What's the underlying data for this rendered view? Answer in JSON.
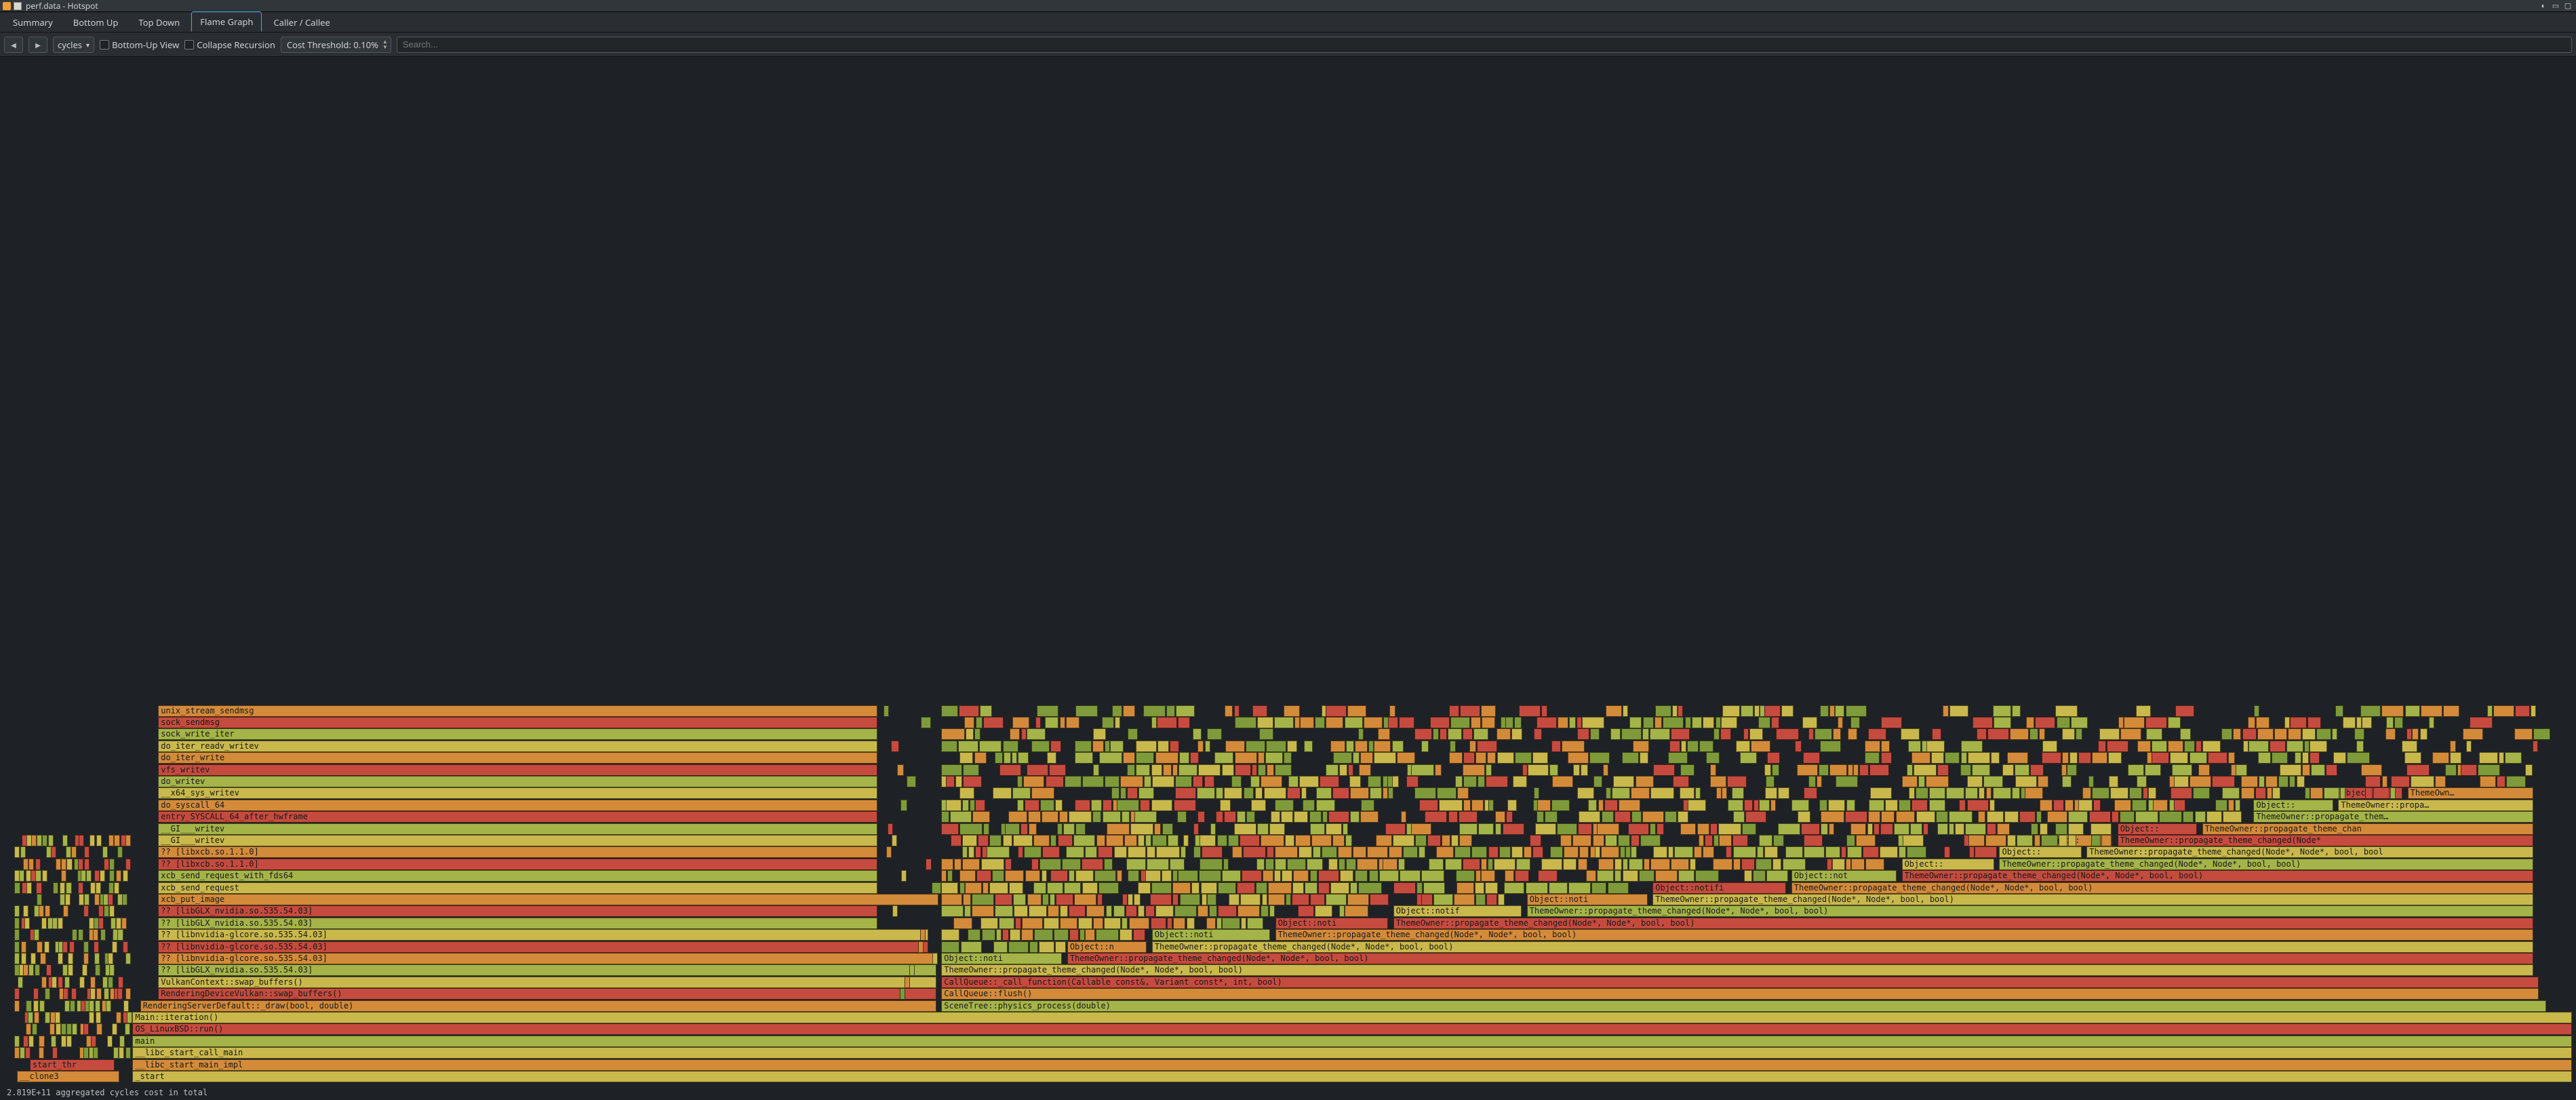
{
  "window": {
    "title": "perf.data - Hotspot"
  },
  "tabs": {
    "summary": "Summary",
    "bottom_up": "Bottom Up",
    "top_down": "Top Down",
    "flame_graph": "Flame Graph",
    "caller_callee": "Caller / Callee",
    "active": "flame_graph"
  },
  "toolbar": {
    "event_selector": "cycles",
    "bottom_up_view": "Bottom-Up View",
    "collapse_recursion": "Collapse Recursion",
    "cost_threshold": "Cost Threshold: 0.10%",
    "search_placeholder": "Search..."
  },
  "status": {
    "text": "2.819E+11 aggregated cycles cost in total"
  },
  "flame": {
    "row_h": 17.4,
    "total_rows": 32,
    "palette": {
      "r": "#c54b3f",
      "o": "#d38b3a",
      "y": "#c9b84c",
      "g": "#a4b448",
      "dg": "#7f9a3a"
    },
    "frames": [
      {
        "row": 0,
        "x": 0.5,
        "w": 4.0,
        "c": "o",
        "label": "__clone3"
      },
      {
        "row": 0,
        "x": 5.0,
        "w": 95.0,
        "c": "y",
        "label": "_start"
      },
      {
        "row": 1,
        "x": 1.0,
        "w": 3.3,
        "c": "r",
        "label": "start_thr"
      },
      {
        "row": 1,
        "x": 5.0,
        "w": 95.0,
        "c": "o",
        "label": "__libc_start_main_impl"
      },
      {
        "row": 2,
        "x": 5.0,
        "w": 95.0,
        "c": "y",
        "label": "__libc_start_call_main"
      },
      {
        "row": 3,
        "x": 5.0,
        "w": 95.0,
        "c": "g",
        "label": "main"
      },
      {
        "row": 4,
        "x": 5.0,
        "w": 95.0,
        "c": "r",
        "label": "OS_LinuxBSD::run()"
      },
      {
        "row": 5,
        "x": 5.0,
        "w": 95.0,
        "c": "y",
        "label": "Main::iteration()"
      },
      {
        "row": 6,
        "x": 5.3,
        "w": 31.0,
        "c": "o",
        "label": "RenderingServerDefault::_draw(bool, double)"
      },
      {
        "row": 6,
        "x": 36.5,
        "w": 62.5,
        "c": "g",
        "label": "SceneTree::physics_process(double)"
      },
      {
        "row": 7,
        "x": 6.0,
        "w": 30.3,
        "c": "r",
        "label": "RenderingDeviceVulkan::swap_buffers()"
      },
      {
        "row": 7,
        "x": 36.5,
        "w": 62.2,
        "c": "o",
        "label": "CallQueue::flush()"
      },
      {
        "row": 8,
        "x": 6.0,
        "w": 30.3,
        "c": "y",
        "label": "VulkanContext::swap_buffers()"
      },
      {
        "row": 8,
        "x": 36.5,
        "w": 62.2,
        "c": "r",
        "label": "CallQueue::_call_function(Callable const&, Variant const*, int, bool)"
      },
      {
        "row": 9,
        "x": 6.0,
        "w": 30.3,
        "c": "g",
        "label": "?? [libGLX_nvidia.so.535.54.03]"
      },
      {
        "row": 9,
        "x": 36.5,
        "w": 62.0,
        "c": "y",
        "label": "ThemeOwner::propagate_theme_changed(Node*, Node*, bool, bool)"
      },
      {
        "row": 10,
        "x": 6.0,
        "w": 30.3,
        "c": "o",
        "label": "?? [libnvidia-glcore.so.535.54.03]"
      },
      {
        "row": 10,
        "x": 36.5,
        "w": 4.7,
        "c": "g",
        "label": "Object::noti"
      },
      {
        "row": 10,
        "x": 41.4,
        "w": 57.1,
        "c": "r",
        "label": "ThemeOwner::propagate_theme_changed(Node*, Node*, bool, bool)"
      },
      {
        "row": 11,
        "x": 6.0,
        "w": 30.0,
        "c": "r",
        "label": "?? [libnvidia-glcore.so.535.54.03]"
      },
      {
        "row": 11,
        "x": 41.4,
        "w": 3.1,
        "c": "o",
        "label": "Object::n"
      },
      {
        "row": 11,
        "x": 44.7,
        "w": 53.8,
        "c": "y",
        "label": "ThemeOwner::propagate_theme_changed(Node*, Node*, bool, bool)"
      },
      {
        "row": 12,
        "x": 6.0,
        "w": 30.0,
        "c": "y",
        "label": "?? [libnvidia-glcore.so.535.54.03]"
      },
      {
        "row": 12,
        "x": 44.7,
        "w": 4.6,
        "c": "g",
        "label": "Object::noti"
      },
      {
        "row": 12,
        "x": 49.5,
        "w": 49.0,
        "c": "o",
        "label": "ThemeOwner::propagate_theme_changed(Node*, Node*, bool, bool)"
      },
      {
        "row": 13,
        "x": 6.0,
        "w": 28.0,
        "c": "g",
        "label": "?? [libGLX_nvidia.so.535.54.03]"
      },
      {
        "row": 13,
        "x": 49.5,
        "w": 4.4,
        "c": "r",
        "label": "Object::noti"
      },
      {
        "row": 13,
        "x": 54.1,
        "w": 44.4,
        "c": "r",
        "label": "ThemeOwner::propagate_theme_changed(Node*, Node*, bool, bool)"
      },
      {
        "row": 14,
        "x": 6.0,
        "w": 28.0,
        "c": "r",
        "label": "?? [libGLX_nvidia.so.535.54.03]"
      },
      {
        "row": 14,
        "x": 54.1,
        "w": 5.0,
        "c": "y",
        "label": "Object::notif"
      },
      {
        "row": 14,
        "x": 59.3,
        "w": 39.2,
        "c": "g",
        "label": "ThemeOwner::propagate_theme_changed(Node*, Node*, bool, bool)"
      },
      {
        "row": 15,
        "x": 6.0,
        "w": 30.4,
        "c": "o",
        "label": "xcb_put_image"
      },
      {
        "row": 15,
        "x": 59.3,
        "w": 4.7,
        "c": "o",
        "label": "Object::noti"
      },
      {
        "row": 15,
        "x": 64.2,
        "w": 34.3,
        "c": "y",
        "label": "ThemeOwner::propagate_theme_changed(Node*, Node*, bool, bool)"
      },
      {
        "row": 16,
        "x": 6.0,
        "w": 28.0,
        "c": "y",
        "label": "xcb_send_request"
      },
      {
        "row": 16,
        "x": 64.2,
        "w": 5.2,
        "c": "r",
        "label": "Object::notifi"
      },
      {
        "row": 16,
        "x": 69.6,
        "w": 28.9,
        "c": "o",
        "label": "ThemeOwner::propagate_theme_changed(Node*, Node*, bool, bool)"
      },
      {
        "row": 17,
        "x": 6.0,
        "w": 28.0,
        "c": "g",
        "label": "xcb_send_request_with_fds64"
      },
      {
        "row": 17,
        "x": 69.6,
        "w": 4.1,
        "c": "g",
        "label": "Object::not"
      },
      {
        "row": 17,
        "x": 73.9,
        "w": 24.6,
        "c": "r",
        "label": "ThemeOwner::propagate_theme_changed(Node*, Node*, bool, bool)"
      },
      {
        "row": 18,
        "x": 6.0,
        "w": 28.0,
        "c": "r",
        "label": "?? [libxcb.so.1.1.0]"
      },
      {
        "row": 18,
        "x": 73.9,
        "w": 3.6,
        "c": "y",
        "label": "Object::"
      },
      {
        "row": 18,
        "x": 77.7,
        "w": 20.8,
        "c": "g",
        "label": "ThemeOwner::propagate_theme_changed(Node*, Node*, bool, bool)"
      },
      {
        "row": 19,
        "x": 6.0,
        "w": 28.0,
        "c": "o",
        "label": "?? [libxcb.so.1.1.0]"
      },
      {
        "row": 19,
        "x": 77.7,
        "w": 3.2,
        "c": "y",
        "label": "Object::"
      },
      {
        "row": 19,
        "x": 81.1,
        "w": 17.4,
        "c": "y",
        "label": "ThemeOwner::propagate_theme_changed(Node*, Node*, bool, bool"
      },
      {
        "row": 20,
        "x": 6.0,
        "w": 28.0,
        "c": "y",
        "label": "__GI___writev"
      },
      {
        "row": 20,
        "x": 79.4,
        "w": 2.7,
        "c": "o",
        "label": "Object:"
      },
      {
        "row": 20,
        "x": 82.3,
        "w": 16.2,
        "c": "r",
        "label": "ThemeOwner::propagate_theme_changed(Node*"
      },
      {
        "row": 21,
        "x": 6.0,
        "w": 28.0,
        "c": "g",
        "label": "__GI___writev"
      },
      {
        "row": 21,
        "x": 82.3,
        "w": 3.1,
        "c": "r",
        "label": "Object::"
      },
      {
        "row": 21,
        "x": 85.6,
        "w": 12.9,
        "c": "o",
        "label": "ThemeOwner::propagate_theme_chan"
      },
      {
        "row": 22,
        "x": 6.0,
        "w": 28.0,
        "c": "r",
        "label": "entry_SYSCALL_64_after_hwframe"
      },
      {
        "row": 22,
        "x": 87.6,
        "w": 10.9,
        "c": "g",
        "label": "ThemeOwner::propagate_them…"
      },
      {
        "row": 23,
        "x": 6.0,
        "w": 28.0,
        "c": "o",
        "label": "do_syscall_64"
      },
      {
        "row": 23,
        "x": 87.6,
        "w": 3.1,
        "c": "g",
        "label": "Object::"
      },
      {
        "row": 23,
        "x": 90.9,
        "w": 7.6,
        "c": "y",
        "label": "ThemeOwner::propa…"
      },
      {
        "row": 24,
        "x": 6.0,
        "w": 28.0,
        "c": "y",
        "label": "__x64_sys_writev"
      },
      {
        "row": 24,
        "x": 90.9,
        "w": 2.5,
        "c": "r",
        "label": "Objec…"
      },
      {
        "row": 24,
        "x": 93.6,
        "w": 4.9,
        "c": "o",
        "label": "ThemeOwn…"
      },
      {
        "row": 25,
        "x": 6.0,
        "w": 28.0,
        "c": "g",
        "label": "do_writev"
      },
      {
        "row": 26,
        "x": 6.0,
        "w": 28.0,
        "c": "r",
        "label": "vfs_writev"
      },
      {
        "row": 27,
        "x": 6.0,
        "w": 28.0,
        "c": "o",
        "label": "do_iter_write"
      },
      {
        "row": 28,
        "x": 6.0,
        "w": 28.0,
        "c": "y",
        "label": "do_iter_readv_writev"
      },
      {
        "row": 29,
        "x": 6.0,
        "w": 28.0,
        "c": "g",
        "label": "sock_write_iter"
      },
      {
        "row": 30,
        "x": 6.0,
        "w": 28.0,
        "c": "r",
        "label": "sock_sendmsg"
      },
      {
        "row": 31,
        "x": 6.0,
        "w": 28.0,
        "c": "o",
        "label": "unix_stream_sendmsg"
      }
    ],
    "noise_seed": 73
  }
}
